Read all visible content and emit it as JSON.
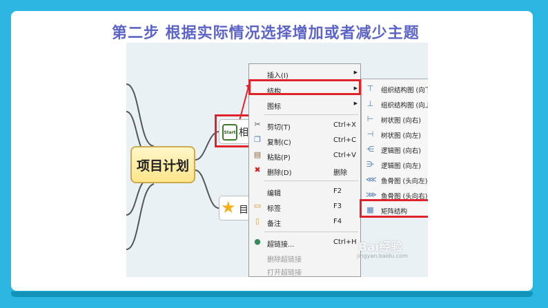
{
  "title": "第二步 根据实际情况选择增加或者减少主题",
  "mindmap": {
    "root_label": "项目计划",
    "node1_icon_text": "Start",
    "node1_label": "相关",
    "node2_label": "目标"
  },
  "context_menu": {
    "items": [
      {
        "label": "插入(I)",
        "shortcut": "",
        "submenu": true
      },
      {
        "label": "结构",
        "shortcut": "",
        "submenu": true
      },
      {
        "label": "图标",
        "shortcut": "",
        "submenu": true
      },
      {
        "label": "剪切(T)",
        "shortcut": "Ctrl+X"
      },
      {
        "label": "复制(C)",
        "shortcut": "Ctrl+C"
      },
      {
        "label": "粘贴(P)",
        "shortcut": "Ctrl+V"
      },
      {
        "label": "删除(D)",
        "shortcut": "删除"
      },
      {
        "label": "编辑",
        "shortcut": "F2"
      },
      {
        "label": "标签",
        "shortcut": "F3"
      },
      {
        "label": "备注",
        "shortcut": "F4"
      },
      {
        "label": "超链接...",
        "shortcut": "Ctrl+H"
      },
      {
        "label": "删除超链接",
        "shortcut": "",
        "disabled": true
      },
      {
        "label": "打开超链接",
        "shortcut": "",
        "disabled": true
      }
    ]
  },
  "structure_submenu": {
    "items": [
      {
        "label": "组织结构图 (向下)"
      },
      {
        "label": "组织结构图 (向上)"
      },
      {
        "label": "树状图 (向右)"
      },
      {
        "label": "树状图 (向左)"
      },
      {
        "label": "逻辑图 (向右)"
      },
      {
        "label": "逻辑图 (向左)"
      },
      {
        "label": "鱼骨图 (头向左)"
      },
      {
        "label": "鱼骨图 (头向右)"
      },
      {
        "label": "矩阵结构"
      }
    ]
  },
  "watermark": {
    "text": "Bai经验",
    "url": "jingyan.baidu.com"
  },
  "colors": {
    "background": "#2ab6e0",
    "title": "#5c64c8",
    "highlight": "#e0232b"
  }
}
